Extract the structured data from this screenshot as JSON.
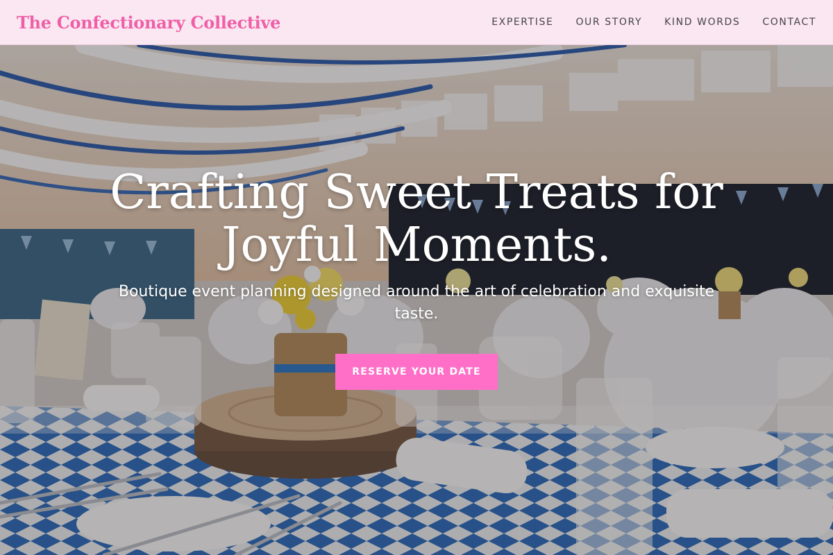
{
  "header": {
    "brand": "The Confectionary Collective",
    "nav": [
      {
        "label": "EXPERTISE"
      },
      {
        "label": "OUR STORY"
      },
      {
        "label": "KIND WORDS"
      },
      {
        "label": "CONTACT"
      }
    ]
  },
  "hero": {
    "title": "Crafting Sweet Treats for Joyful Moments.",
    "subtitle": "Boutique event planning designed around the art of celebration and exquisite taste.",
    "cta_label": "RESERVE YOUR DATE",
    "background": "photo of a decorated banquet hall with blue-and-white diamond tablecloths, wood slice centerpieces with flower jars, glasses and white chair covers"
  },
  "colors": {
    "brand": "#ef5fa7",
    "header_bg": "#fbe7f1",
    "cta_bg": "#ff6ec7",
    "tablecloth_blue": "#2f6fc0"
  }
}
